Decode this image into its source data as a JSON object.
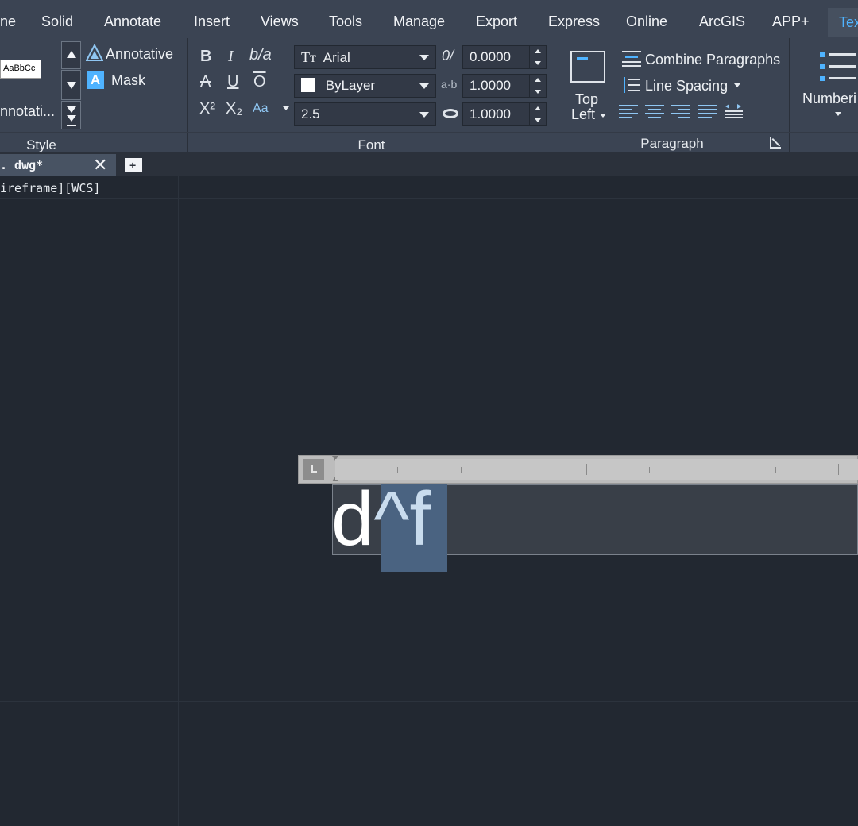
{
  "ribbon_tabs": [
    "ne",
    "Solid",
    "Annotate",
    "Insert",
    "Views",
    "Tools",
    "Manage",
    "Export",
    "Express",
    "Online",
    "ArcGIS",
    "APP+",
    "Tex"
  ],
  "style_panel": {
    "preview_text": "AaBbCc",
    "style_name": "nnotati...",
    "annotative_label": "Annotative",
    "mask_label": "Mask",
    "title": "Style"
  },
  "font_panel": {
    "title": "Font",
    "font_name": "Arial",
    "color_name": "ByLayer",
    "text_height": "2.5",
    "oblique_angle": "0.0000",
    "tracking": "1.0000",
    "width_factor": "1.0000",
    "bold": "B",
    "italic": "I",
    "stack": "b/a",
    "strike": "A",
    "underline": "U",
    "overline": "O",
    "superscript": "X²",
    "subscript": "X₂",
    "case": "Aa"
  },
  "paragraph_panel": {
    "title": "Paragraph",
    "justify_line1": "Top",
    "justify_line2": "Left",
    "combine_label": "Combine Paragraphs",
    "line_spacing_label": "Line Spacing"
  },
  "numbering_label": "Numberi",
  "doc_tab": {
    "name": ". dwg*"
  },
  "viewport_label": "ireframe][WCS]",
  "mtext": {
    "plain": "d",
    "selected": "^f"
  },
  "colors": {
    "accent": "#4fb3ff",
    "background": "#222831",
    "ribbon": "#3b4453",
    "selection": "#4a6381"
  }
}
